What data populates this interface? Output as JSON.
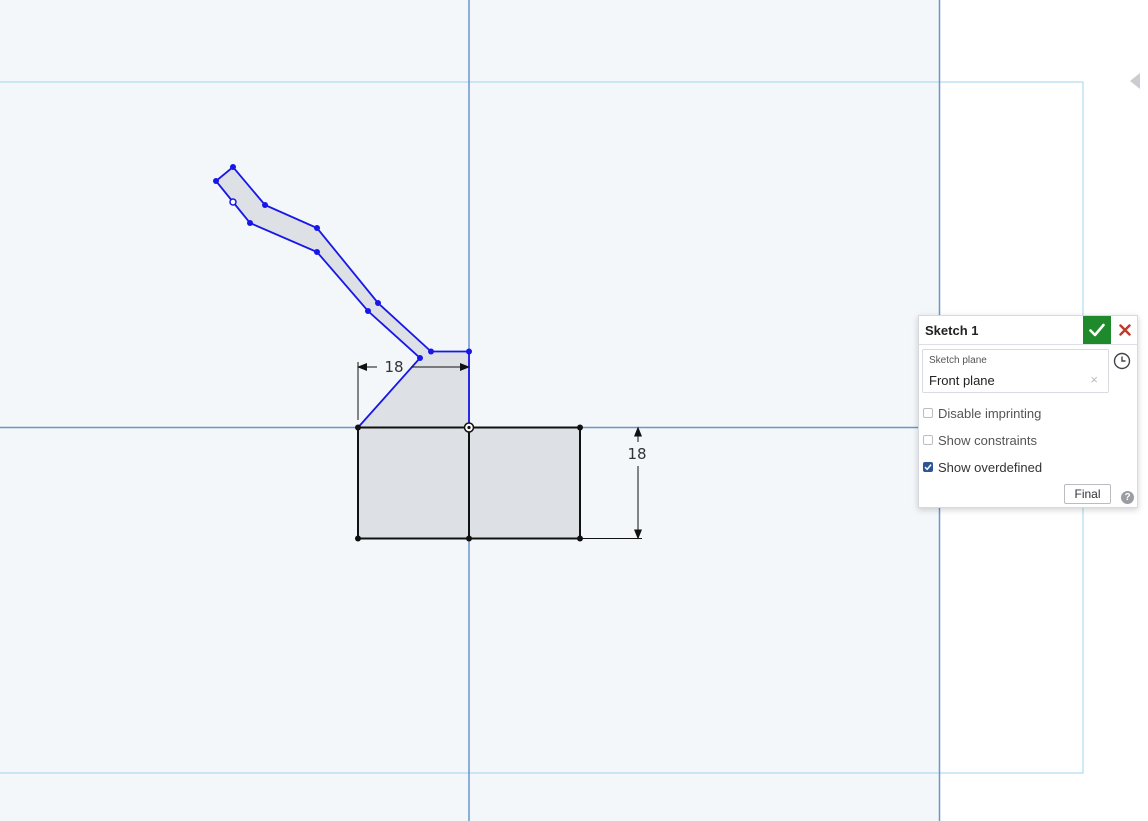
{
  "sketch": {
    "horizontal_dimension": "18",
    "vertical_dimension": "18"
  },
  "panel": {
    "title": "Sketch 1",
    "accept_icon": "checkmark-icon",
    "cancel_icon": "close-icon",
    "sketch_plane_label": "Sketch plane",
    "sketch_plane_value": "Front plane",
    "clear_icon": "close-icon",
    "history_icon": "clock-icon",
    "options": [
      {
        "label": "Disable imprinting",
        "checked": false
      },
      {
        "label": "Show constraints",
        "checked": false
      },
      {
        "label": "Show overdefined",
        "checked": true
      }
    ],
    "final_label": "Final",
    "help_icon": "help-icon"
  },
  "colors": {
    "canvas_background": "#f3f7fa",
    "sketch_selected": "#1717e8",
    "region_fill": "#dde1e5",
    "axis_line": "#6b96cc",
    "plane_outline": "#9fd6ee",
    "accept_green": "#1f8a2b",
    "cancel_red": "#c0392b"
  }
}
